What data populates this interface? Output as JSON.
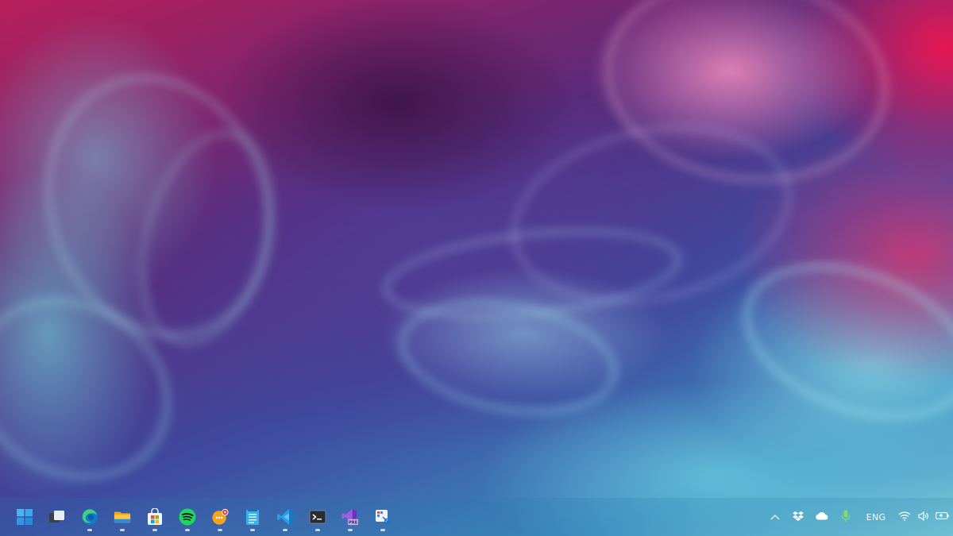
{
  "desktop": {
    "wallpaper": "abstract-smoke-wallpaper",
    "colors": {
      "magenta": "#e8185a",
      "purple": "#4a3a8c",
      "cyan": "#8fd8e0"
    }
  },
  "taskbar": {
    "pinned": [
      {
        "name": "start",
        "icon": "windows-logo-icon",
        "running": false
      },
      {
        "name": "task-view",
        "icon": "task-view-icon",
        "running": false
      },
      {
        "name": "edge",
        "icon": "edge-icon",
        "running": true
      },
      {
        "name": "file-explorer",
        "icon": "folder-icon",
        "running": true
      },
      {
        "name": "microsoft-store",
        "icon": "store-icon",
        "running": true
      },
      {
        "name": "spotify",
        "icon": "spotify-icon",
        "running": true
      },
      {
        "name": "chat-app",
        "icon": "chat-icon",
        "running": true
      },
      {
        "name": "notepad",
        "icon": "notepad-icon",
        "running": true
      },
      {
        "name": "vs-code",
        "icon": "vscode-icon",
        "running": true
      },
      {
        "name": "terminal",
        "icon": "terminal-icon",
        "running": true
      },
      {
        "name": "visual-studio-preview",
        "icon": "visual-studio-icon",
        "running": true,
        "badge": "PRE"
      },
      {
        "name": "snipping-tool",
        "icon": "snipping-tool-icon",
        "running": true
      }
    ],
    "tray": {
      "language": "ENG",
      "icons": [
        "chevron-up-icon",
        "dropbox-icon",
        "onedrive-icon",
        "microphone-icon",
        "wifi-icon",
        "volume-icon",
        "battery-icon"
      ]
    }
  }
}
